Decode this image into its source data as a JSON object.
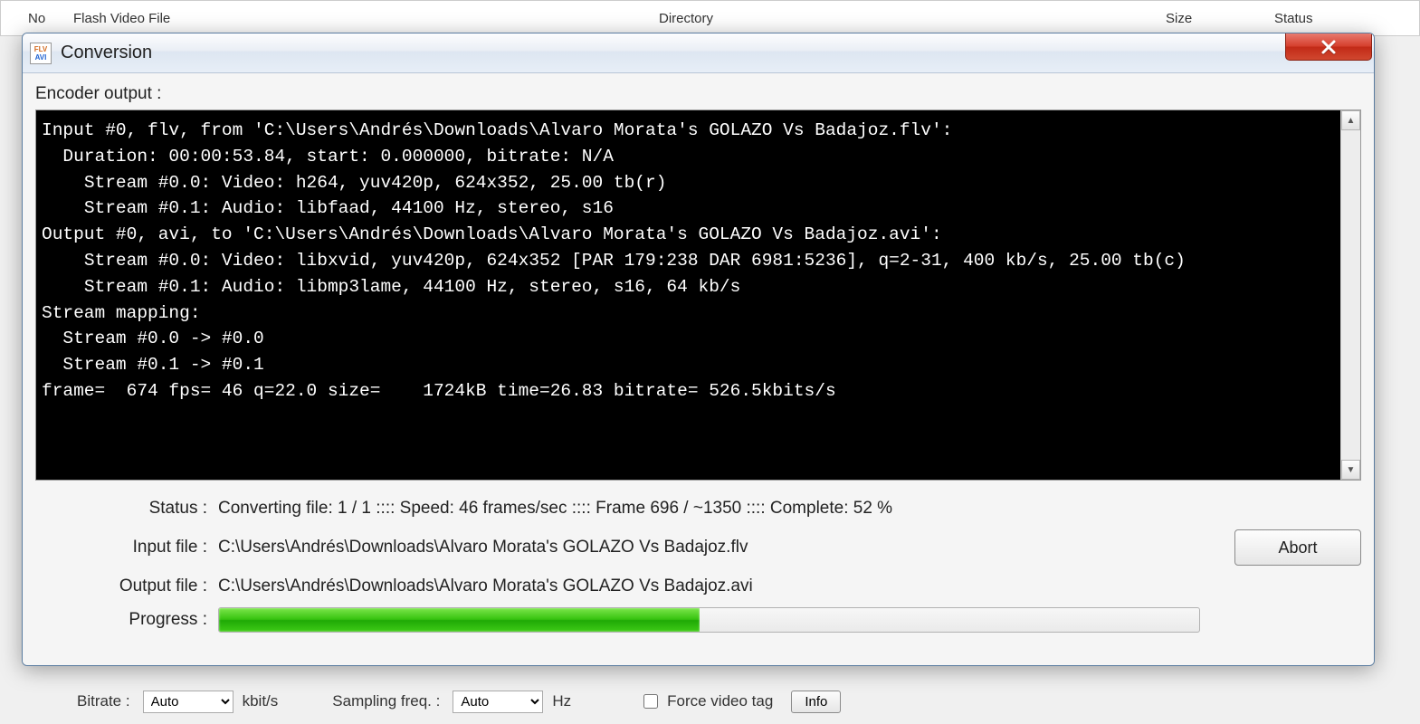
{
  "background": {
    "columns": {
      "no": "No",
      "flash": "Flash Video File",
      "directory": "Directory",
      "size": "Size",
      "status": "Status"
    },
    "bottom": {
      "bitrate_label": "Bitrate :",
      "bitrate_value": "Auto",
      "bitrate_unit": "kbit/s",
      "sampling_label": "Sampling freq. :",
      "sampling_value": "Auto",
      "sampling_unit": "Hz",
      "force_video_tag": "Force video tag",
      "info_button": "Info"
    }
  },
  "dialog": {
    "title": "Conversion",
    "encoder_output_label": "Encoder output :",
    "console_text": "Input #0, flv, from 'C:\\Users\\Andrés\\Downloads\\Alvaro Morata's GOLAZO Vs Badajoz.flv':\n  Duration: 00:00:53.84, start: 0.000000, bitrate: N/A\n    Stream #0.0: Video: h264, yuv420p, 624x352, 25.00 tb(r)\n    Stream #0.1: Audio: libfaad, 44100 Hz, stereo, s16\nOutput #0, avi, to 'C:\\Users\\Andrés\\Downloads\\Alvaro Morata's GOLAZO Vs Badajoz.avi':\n    Stream #0.0: Video: libxvid, yuv420p, 624x352 [PAR 179:238 DAR 6981:5236], q=2-31, 400 kb/s, 25.00 tb(c)\n    Stream #0.1: Audio: libmp3lame, 44100 Hz, stereo, s16, 64 kb/s\nStream mapping:\n  Stream #0.0 -> #0.0\n  Stream #0.1 -> #0.1\nframe=  674 fps= 46 q=22.0 size=    1724kB time=26.83 bitrate= 526.5kbits/s",
    "status_label": "Status :",
    "status_value": "Converting file: 1 / 1  ::::  Speed: 46 frames/sec  ::::  Frame 696 / ~1350  ::::  Complete: 52 %",
    "input_label": "Input file :",
    "input_value": "C:\\Users\\Andrés\\Downloads\\Alvaro Morata's GOLAZO Vs Badajoz.flv",
    "output_label": "Output file :",
    "output_value": "C:\\Users\\Andrés\\Downloads\\Alvaro Morata's GOLAZO Vs Badajoz.avi",
    "progress_label": "Progress :",
    "progress_percent": 49,
    "abort_label": "Abort"
  }
}
